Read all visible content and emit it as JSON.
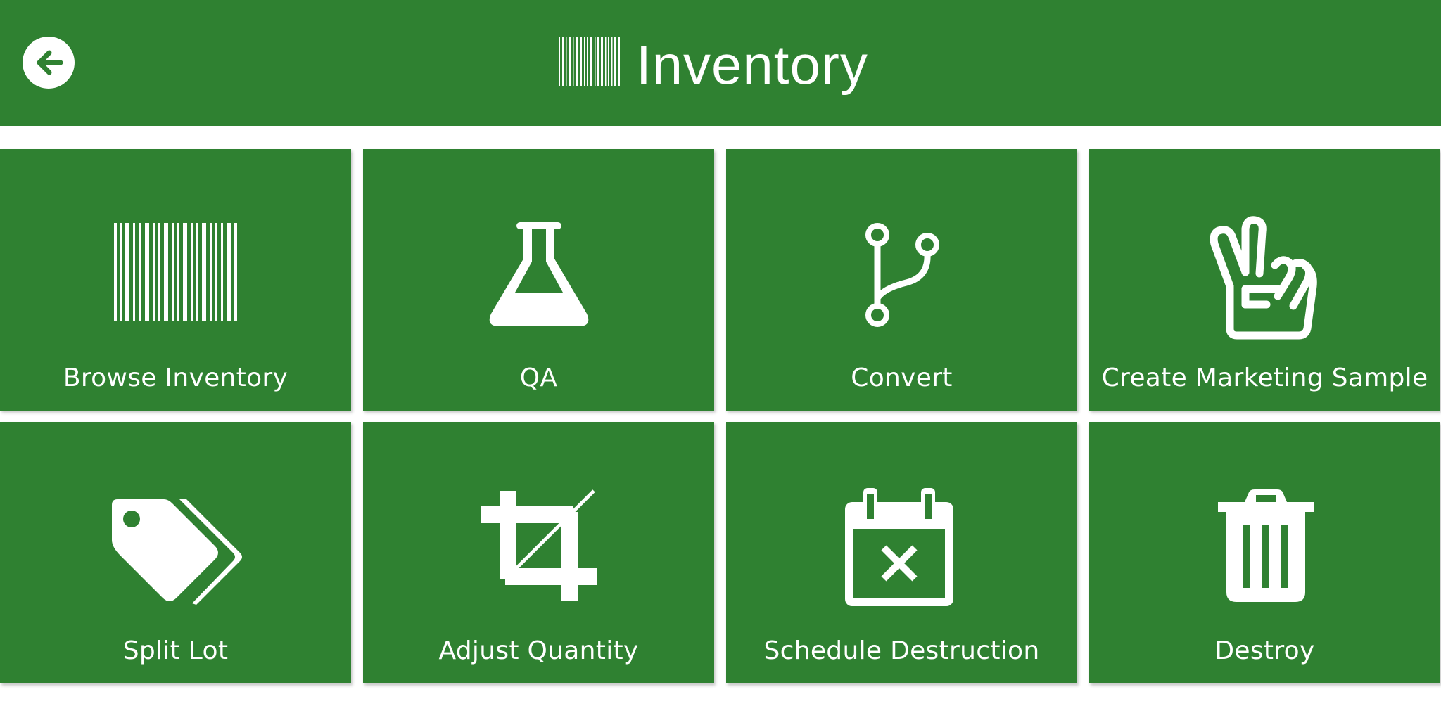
{
  "header": {
    "title": "Inventory",
    "back_icon": "arrow-left-circle-icon",
    "title_icon": "barcode-icon"
  },
  "colors": {
    "primary": "#2f8131",
    "foreground": "#ffffff",
    "background": "#ffffff"
  },
  "tiles": [
    {
      "label": "Browse Inventory",
      "icon": "barcode-icon"
    },
    {
      "label": "QA",
      "icon": "flask-icon"
    },
    {
      "label": "Convert",
      "icon": "branch-icon"
    },
    {
      "label": "Create Marketing Sample",
      "icon": "peace-hand-icon"
    },
    {
      "label": "Split Lot",
      "icon": "tags-icon"
    },
    {
      "label": "Adjust Quantity",
      "icon": "crop-icon"
    },
    {
      "label": "Schedule Destruction",
      "icon": "calendar-cross-icon"
    },
    {
      "label": "Destroy",
      "icon": "trash-icon"
    }
  ]
}
